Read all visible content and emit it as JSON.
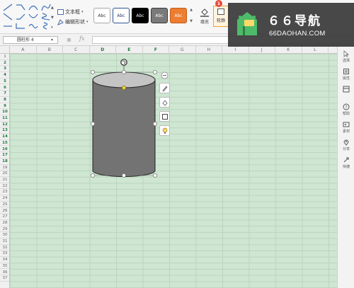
{
  "ribbon": {
    "text_box_label": "文本框",
    "edit_shape_label": "编辑形状",
    "style_buttons": [
      {
        "label": "Abc",
        "bg": "#ffffff",
        "fg": "#333333",
        "border": "#a8a8a8"
      },
      {
        "label": "Abc",
        "bg": "#ffffff",
        "fg": "#1f3864",
        "border": "#2f5597"
      },
      {
        "label": "Abc",
        "bg": "#000000",
        "fg": "#ffffff",
        "border": "#000000"
      },
      {
        "label": "Abc",
        "bg": "#7a7a7a",
        "fg": "#ffffff",
        "border": "#3a3a3a"
      },
      {
        "label": "Abc",
        "bg": "#ed7d31",
        "fg": "#ffffff",
        "border": "#c05a17"
      }
    ],
    "fill_label": "填充",
    "outline_label": "轮廓",
    "outline_badge": "1"
  },
  "formula_bar": {
    "name_box": "圆柱形 4",
    "fx_label": "fx",
    "formula": ""
  },
  "columns": [
    "A",
    "B",
    "C",
    "D",
    "E",
    "F",
    "G",
    "H",
    "I",
    "J",
    "K",
    "L"
  ],
  "selected_columns": [
    "D",
    "E",
    "F"
  ],
  "rows": [
    "1",
    "2",
    "3",
    "4",
    "5",
    "6",
    "7",
    "8",
    "9",
    "10",
    "11",
    "12",
    "13",
    "14",
    "15",
    "16",
    "17",
    "18",
    "19",
    "20",
    "21",
    "22",
    "23",
    "24",
    "25",
    "26",
    "27",
    "28",
    "29",
    "30",
    "31",
    "32",
    "33",
    "34",
    "35",
    "36",
    "37"
  ],
  "selected_rows_range": [
    2,
    18
  ],
  "shape": {
    "type": "cylinder",
    "body_color": "#737373",
    "top_color": "#c4c4c4",
    "outline_color": "#222222"
  },
  "floating_tools": [
    "collapse-icon",
    "brush-icon",
    "shape-fill-icon",
    "frame-icon",
    "bulb-icon"
  ],
  "task_pane": [
    {
      "label": "选择",
      "icon": "select-icon"
    },
    {
      "label": "属性",
      "icon": "properties-icon"
    },
    {
      "label": "",
      "icon": "layout-icon"
    },
    {
      "label": "帮助",
      "icon": "help-icon"
    },
    {
      "label": "素材",
      "icon": "material-icon"
    },
    {
      "label": "分享",
      "icon": "location-icon"
    },
    {
      "label": "快捷",
      "icon": "shortcut-icon"
    }
  ],
  "watermark": {
    "title": "６６导航",
    "url": "66DAOHAN.COM"
  }
}
